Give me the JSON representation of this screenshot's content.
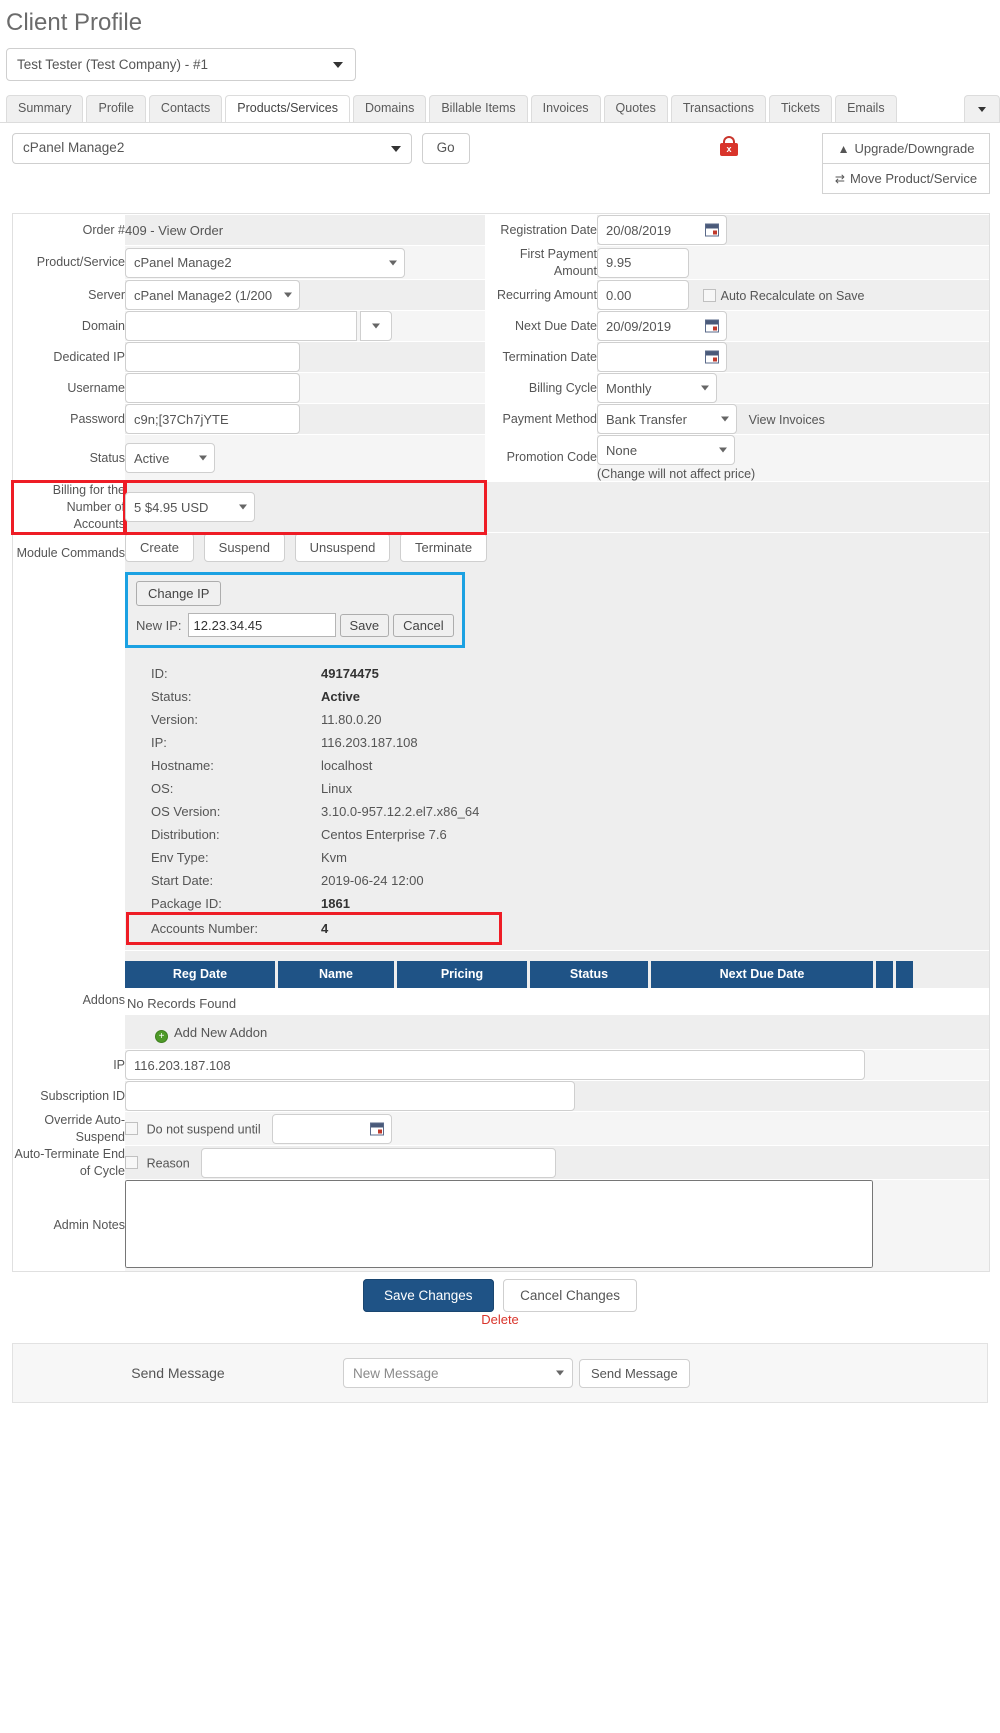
{
  "header": {
    "page_title": "Client Profile",
    "client_selector_value": "Test Tester (Test Company) - #1"
  },
  "tabs": [
    {
      "label": "Summary",
      "active": false
    },
    {
      "label": "Profile",
      "active": false
    },
    {
      "label": "Contacts",
      "active": false
    },
    {
      "label": "Products/Services",
      "active": true
    },
    {
      "label": "Domains",
      "active": false
    },
    {
      "label": "Billable Items",
      "active": false
    },
    {
      "label": "Invoices",
      "active": false
    },
    {
      "label": "Quotes",
      "active": false
    },
    {
      "label": "Transactions",
      "active": false
    },
    {
      "label": "Tickets",
      "active": false
    },
    {
      "label": "Emails",
      "active": false
    }
  ],
  "toolbar": {
    "product_selector_value": "cPanel Manage2",
    "go_label": "Go",
    "lock_icon": "lock-red-icon",
    "upgrade_label": "Upgrade/Downgrade",
    "move_label": "Move Product/Service"
  },
  "form_left": {
    "order_label": "Order #",
    "order_value": "409 - View Order",
    "product_label": "Product/Service",
    "product_value": "cPanel Manage2",
    "server_label": "Server",
    "server_value": "cPanel Manage2 (1/200",
    "domain_label": "Domain",
    "domain_value": "",
    "dedicated_ip_label": "Dedicated IP",
    "dedicated_ip_value": "",
    "username_label": "Username",
    "username_value": "",
    "password_label": "Password",
    "password_value": "c9n;[37Ch7jYTE",
    "status_label": "Status",
    "status_value": "Active"
  },
  "form_right": {
    "registration_date_label": "Registration Date",
    "registration_date_value": "20/08/2019",
    "first_payment_label": "First Payment Amount",
    "first_payment_value": "9.95",
    "recurring_label": "Recurring Amount",
    "recurring_value": "0.00",
    "auto_recalculate_label": "Auto Recalculate on Save",
    "next_due_label": "Next Due Date",
    "next_due_value": "20/09/2019",
    "termination_label": "Termination Date",
    "termination_value": "",
    "billing_cycle_label": "Billing Cycle",
    "billing_cycle_value": "Monthly",
    "payment_method_label": "Payment Method",
    "payment_method_value": "Bank Transfer",
    "view_invoices_label": "View Invoices",
    "promotion_label": "Promotion Code",
    "promotion_value": "None",
    "promotion_note": "(Change will not affect price)"
  },
  "billing_accounts": {
    "label": "Billing for the Number of Accounts",
    "value": "5 $4.95 USD",
    "highlight_color": "#ee1c25"
  },
  "module_commands": {
    "label": "Module Commands",
    "buttons": [
      "Create",
      "Suspend",
      "Unsuspend",
      "Terminate"
    ],
    "change_ip_label": "Change IP",
    "new_ip_label": "New IP:",
    "new_ip_value": "12.23.34.45",
    "save_label": "Save",
    "cancel_label": "Cancel",
    "highlight_color": "#1ba1e2"
  },
  "server_details": [
    {
      "key": "ID:",
      "value": "49174475",
      "bold": true
    },
    {
      "key": "Status:",
      "value": "Active",
      "bold": true
    },
    {
      "key": "Version:",
      "value": "11.80.0.20",
      "bold": false
    },
    {
      "key": "IP:",
      "value": "116.203.187.108",
      "bold": false
    },
    {
      "key": "Hostname:",
      "value": "localhost",
      "bold": false
    },
    {
      "key": "OS:",
      "value": "Linux",
      "bold": false
    },
    {
      "key": "OS Version:",
      "value": "3.10.0-957.12.2.el7.x86_64",
      "bold": false
    },
    {
      "key": "Distribution:",
      "value": "Centos Enterprise 7.6",
      "bold": false
    },
    {
      "key": "Env Type:",
      "value": "Kvm",
      "bold": false
    },
    {
      "key": "Start Date:",
      "value": "2019-06-24 12:00",
      "bold": false
    },
    {
      "key": "Package ID:",
      "value": "1861",
      "bold": true
    },
    {
      "key": "Accounts Number:",
      "value": "4",
      "bold": true,
      "highlight": true
    }
  ],
  "addons": {
    "label": "Addons",
    "columns": [
      "Reg Date",
      "Name",
      "Pricing",
      "Status",
      "Next Due Date"
    ],
    "empty_text": "No Records Found",
    "add_new_label": "Add New Addon"
  },
  "bottom_form": {
    "ip_label": "IP",
    "ip_value": "116.203.187.108",
    "subscription_label": "Subscription ID",
    "subscription_value": "",
    "override_label": "Override Auto-Suspend",
    "do_not_suspend_label": "Do not suspend until",
    "do_not_suspend_value": "",
    "auto_terminate_label": "Auto-Terminate End of Cycle",
    "reason_label": "Reason",
    "reason_value": "",
    "admin_notes_label": "Admin Notes",
    "admin_notes_value": ""
  },
  "actions": {
    "save_changes": "Save Changes",
    "cancel_changes": "Cancel Changes",
    "delete": "Delete"
  },
  "send_message": {
    "label": "Send Message",
    "select_placeholder": "New Message",
    "button_label": "Send Message"
  }
}
